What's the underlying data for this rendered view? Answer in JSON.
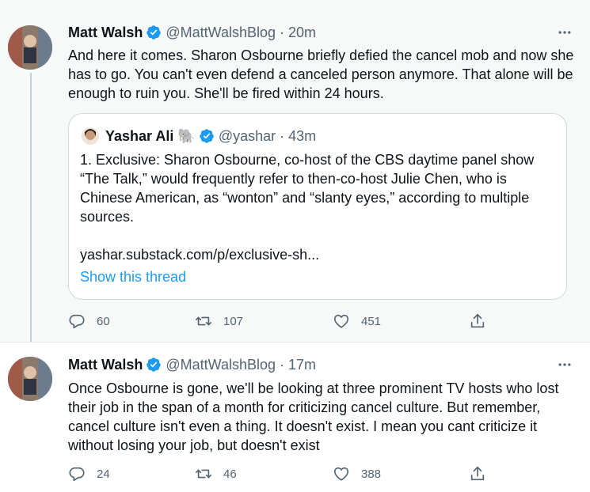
{
  "tweets": [
    {
      "author_name": "Matt Walsh",
      "author_handle": "@MattWalshBlog",
      "separator": "·",
      "time": "20m",
      "more_icon": "more-horizontal-icon",
      "text": "And here it comes. Sharon Osbourne briefly defied the cancel mob and now she has to go. You can't even defend a canceled person anymore. That alone will be enough to ruin you. She'll be fired within 24 hours.",
      "quoted": {
        "author_name": "Yashar Ali",
        "emoji": "🐘",
        "author_handle": "@yashar",
        "separator": "·",
        "time": "43m",
        "text": "1. Exclusive: Sharon Osbourne, co-host of the CBS daytime panel show “The Talk,” would frequently refer to then-co-host Julie Chen, who is Chinese American, as “wonton” and “slanty eyes,” according to multiple sources.",
        "link": "yashar.substack.com/p/exclusive-sh...",
        "show_thread": "Show this thread"
      },
      "stats": {
        "replies": "60",
        "retweets": "107",
        "likes": "451"
      }
    },
    {
      "author_name": "Matt Walsh",
      "author_handle": "@MattWalshBlog",
      "separator": "·",
      "time": "17m",
      "more_icon": "more-horizontal-icon",
      "text": "Once Osbourne is gone, we'll be looking at three prominent TV hosts who lost their job in the span of a month for criticizing cancel culture. But remember, cancel culture isn't even a thing. It doesn't exist. I mean you cant criticize it without losing your job, but doesn't exist",
      "stats": {
        "replies": "24",
        "retweets": "46",
        "likes": "388"
      }
    }
  ],
  "colors": {
    "accent": "#1d9bf0",
    "muted": "#536471",
    "thread_line": "#c4cfd6",
    "highlight_bg": "#f7f9f9"
  }
}
